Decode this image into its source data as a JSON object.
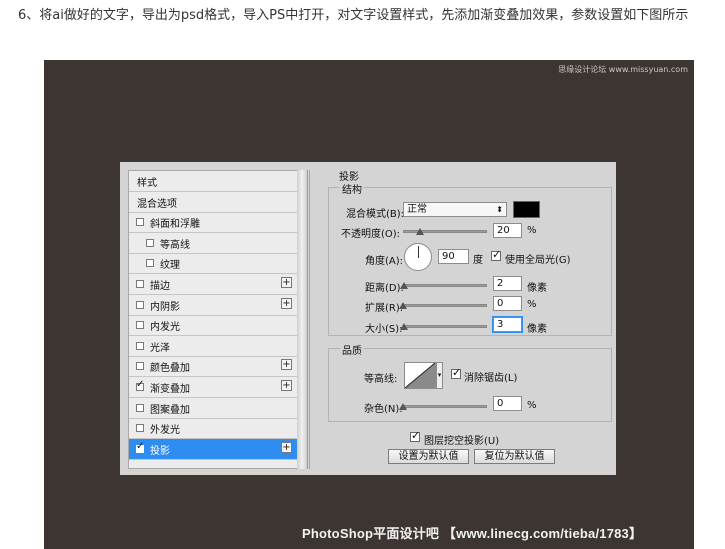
{
  "article": {
    "text": "6、将ai做好的文字，导出为psd格式，导入PS中打开，对文字设置样式，先添加渐变叠加效果，参数设置如下图所示"
  },
  "watermarks": {
    "top": "思缘设计论坛 www.missyuan.com",
    "bottom": "PhotoShop平面设计吧 【www.linecg.com/tieba/1783】"
  },
  "styles_panel": {
    "items": [
      {
        "label": "样式",
        "checkbox": false,
        "checked": false,
        "plus": false,
        "indent": 0,
        "selected": false
      },
      {
        "label": "混合选项",
        "checkbox": false,
        "checked": false,
        "plus": false,
        "indent": 0,
        "selected": false
      },
      {
        "label": "斜面和浮雕",
        "checkbox": true,
        "checked": false,
        "plus": false,
        "indent": 0,
        "selected": false
      },
      {
        "label": "等高线",
        "checkbox": true,
        "checked": false,
        "plus": false,
        "indent": 1,
        "selected": false
      },
      {
        "label": "纹理",
        "checkbox": true,
        "checked": false,
        "plus": false,
        "indent": 1,
        "selected": false
      },
      {
        "label": "描边",
        "checkbox": true,
        "checked": false,
        "plus": true,
        "indent": 0,
        "selected": false
      },
      {
        "label": "内阴影",
        "checkbox": true,
        "checked": false,
        "plus": true,
        "indent": 0,
        "selected": false
      },
      {
        "label": "内发光",
        "checkbox": true,
        "checked": false,
        "plus": false,
        "indent": 0,
        "selected": false
      },
      {
        "label": "光泽",
        "checkbox": true,
        "checked": false,
        "plus": false,
        "indent": 0,
        "selected": false
      },
      {
        "label": "颜色叠加",
        "checkbox": true,
        "checked": false,
        "plus": true,
        "indent": 0,
        "selected": false
      },
      {
        "label": "渐变叠加",
        "checkbox": true,
        "checked": true,
        "plus": true,
        "indent": 0,
        "selected": false
      },
      {
        "label": "图案叠加",
        "checkbox": true,
        "checked": false,
        "plus": false,
        "indent": 0,
        "selected": false
      },
      {
        "label": "外发光",
        "checkbox": true,
        "checked": false,
        "plus": false,
        "indent": 0,
        "selected": false
      },
      {
        "label": "投影",
        "checkbox": true,
        "checked": true,
        "plus": true,
        "indent": 0,
        "selected": true
      }
    ]
  },
  "drop_shadow": {
    "section_title": "投影",
    "structure_title": "结构",
    "blend_mode_label": "混合模式(B):",
    "blend_mode_value": "正常",
    "opacity_label": "不透明度(O):",
    "opacity_value": "20",
    "opacity_unit": "%",
    "opacity_fraction": 0.2,
    "angle_label": "角度(A):",
    "angle_value": "90",
    "angle_unit": "度",
    "global_light_label": "使用全局光(G)",
    "global_light_checked": true,
    "distance_label": "距离(D):",
    "distance_value": "2",
    "distance_unit": "像素",
    "distance_fraction": 0.01,
    "spread_label": "扩展(R):",
    "spread_value": "0",
    "spread_unit": "%",
    "spread_fraction": 0,
    "size_label": "大小(S):",
    "size_value": "3",
    "size_unit": "像素",
    "size_fraction": 0.01,
    "quality_title": "品质",
    "contour_label": "等高线:",
    "antialias_label": "消除锯齿(L)",
    "antialias_checked": true,
    "noise_label": "杂色(N):",
    "noise_value": "0",
    "noise_unit": "%",
    "noise_fraction": 0,
    "knockout_label": "图层挖空投影(U)",
    "knockout_checked": true,
    "make_default_label": "设置为默认值",
    "reset_default_label": "复位为默认值",
    "shadow_color": "#000000"
  },
  "colors": {
    "background_dark": "#3d3532",
    "dialog_bg": "#d4d4d4",
    "selection_blue": "#2f8cf0"
  }
}
